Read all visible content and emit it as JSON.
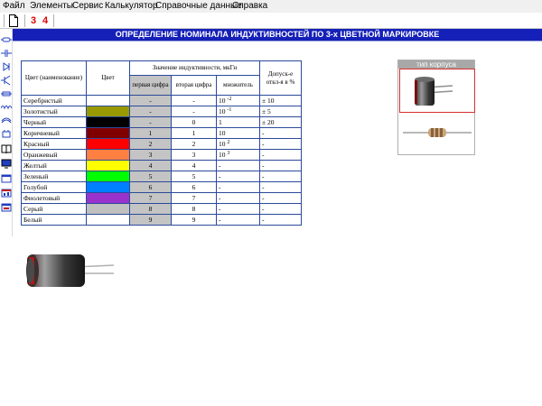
{
  "menu": [
    "Файл",
    "Элементы",
    "Сервис",
    "Калькулятор",
    "Справочные данные",
    "Справка"
  ],
  "toolbar": {
    "new_doc_icon": "document-icon",
    "btn3": "3",
    "btn4": "4",
    "accent": "#e00000"
  },
  "title": "ОПРЕДЕЛЕНИЕ НОМИНАЛА ИНДУКТИВНОСТЕЙ ПО 3-х ЦВЕТНОЙ МАРКИРОВКЕ",
  "table": {
    "headers": {
      "color_name": "Цвет (наименование)",
      "color": "Цвет",
      "value": "Значение индуктивности, мкГн",
      "first": "первая цифра",
      "second": "вторая цифра",
      "multiplier": "множитель",
      "tolerance": "Допуск-е откл-я в %"
    },
    "rows": [
      {
        "name": "Серебристый",
        "swatch": "#ffffff",
        "d1": "-",
        "d2": "-",
        "mult": "10",
        "exp": "-2",
        "tol": "± 10"
      },
      {
        "name": "Золотистый",
        "swatch": "#999900",
        "d1": "-",
        "d2": "-",
        "mult": "10",
        "exp": "-1",
        "tol": "± 5"
      },
      {
        "name": "Черный",
        "swatch": "#000000",
        "d1": "-",
        "d2": "0",
        "mult": "1",
        "exp": "",
        "tol": "± 20"
      },
      {
        "name": "Коричневый",
        "swatch": "#800000",
        "d1": "1",
        "d2": "1",
        "mult": "10",
        "exp": "",
        "tol": "-"
      },
      {
        "name": "Красный",
        "swatch": "#ff0000",
        "d1": "2",
        "d2": "2",
        "mult": "10",
        "exp": "2",
        "tol": "-"
      },
      {
        "name": "Оранжевый",
        "swatch": "#ff8040",
        "d1": "3",
        "d2": "3",
        "mult": "10",
        "exp": "3",
        "tol": "-"
      },
      {
        "name": "Желтый",
        "swatch": "#ffff00",
        "d1": "4",
        "d2": "4",
        "mult": "-",
        "exp": "",
        "tol": "-"
      },
      {
        "name": "Зеленый",
        "swatch": "#00ff00",
        "d1": "5",
        "d2": "5",
        "mult": "-",
        "exp": "",
        "tol": "-"
      },
      {
        "name": "Голубой",
        "swatch": "#0080ff",
        "d1": "6",
        "d2": "6",
        "mult": "-",
        "exp": "",
        "tol": "-"
      },
      {
        "name": "Фиолетовый",
        "swatch": "#9933cc",
        "d1": "7",
        "d2": "7",
        "mult": "-",
        "exp": "",
        "tol": "-"
      },
      {
        "name": "Серый",
        "swatch": "#c0c0c0",
        "d1": "8",
        "d2": "8",
        "mult": "-",
        "exp": "",
        "tol": "-"
      },
      {
        "name": "Белый",
        "swatch": "#ffffff",
        "d1": "9",
        "d2": "9",
        "mult": "-",
        "exp": "",
        "tol": "-"
      }
    ]
  },
  "panel": {
    "title": "тип корпуса",
    "options": [
      "radial-inductor-icon",
      "axial-inductor-icon"
    ],
    "selected": 0,
    "select_color": "#d83030"
  },
  "preview": {
    "icon": "radial-inductor-icon"
  }
}
